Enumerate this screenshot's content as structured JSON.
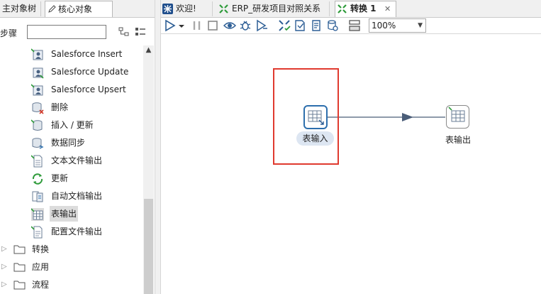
{
  "left_panel": {
    "tabs": {
      "main_tree": "主对象树",
      "core_objects": "核心对象"
    },
    "steps_label": "步骤",
    "search_placeholder": "",
    "tree_items": [
      {
        "label": "Salesforce Insert",
        "icon": "salesforce-insert-icon"
      },
      {
        "label": "Salesforce Update",
        "icon": "salesforce-update-icon"
      },
      {
        "label": "Salesforce Upsert",
        "icon": "salesforce-upsert-icon"
      },
      {
        "label": "删除",
        "icon": "delete-step-icon"
      },
      {
        "label": "插入 / 更新",
        "icon": "insert-update-icon"
      },
      {
        "label": "数据同步",
        "icon": "data-sync-icon"
      },
      {
        "label": "文本文件输出",
        "icon": "text-file-output-icon"
      },
      {
        "label": "更新",
        "icon": "update-icon"
      },
      {
        "label": "自动文档输出",
        "icon": "auto-doc-output-icon"
      },
      {
        "label": "表输出",
        "icon": "table-output-icon",
        "selected": true
      },
      {
        "label": "配置文件输出",
        "icon": "config-file-output-icon"
      }
    ],
    "folders": [
      {
        "label": "转换"
      },
      {
        "label": "应用"
      },
      {
        "label": "流程"
      }
    ]
  },
  "editor": {
    "tabs": [
      {
        "label": "欢迎!",
        "icon": "welcome-icon"
      },
      {
        "label": "ERP_研发项目对照关系",
        "icon": "transformation-icon"
      },
      {
        "label": "转换 1",
        "icon": "transformation-icon",
        "active": true,
        "close": "✕"
      }
    ],
    "zoom": "100%",
    "steps": [
      {
        "label": "表输入",
        "icon": "table-input-icon"
      },
      {
        "label": "表输出",
        "icon": "table-output-icon"
      }
    ]
  },
  "colors": {
    "highlight": "#e03a2f",
    "selected_step_border": "#2d6fad",
    "hop": "#4a5d78",
    "accent_green": "#2e9b3a"
  }
}
